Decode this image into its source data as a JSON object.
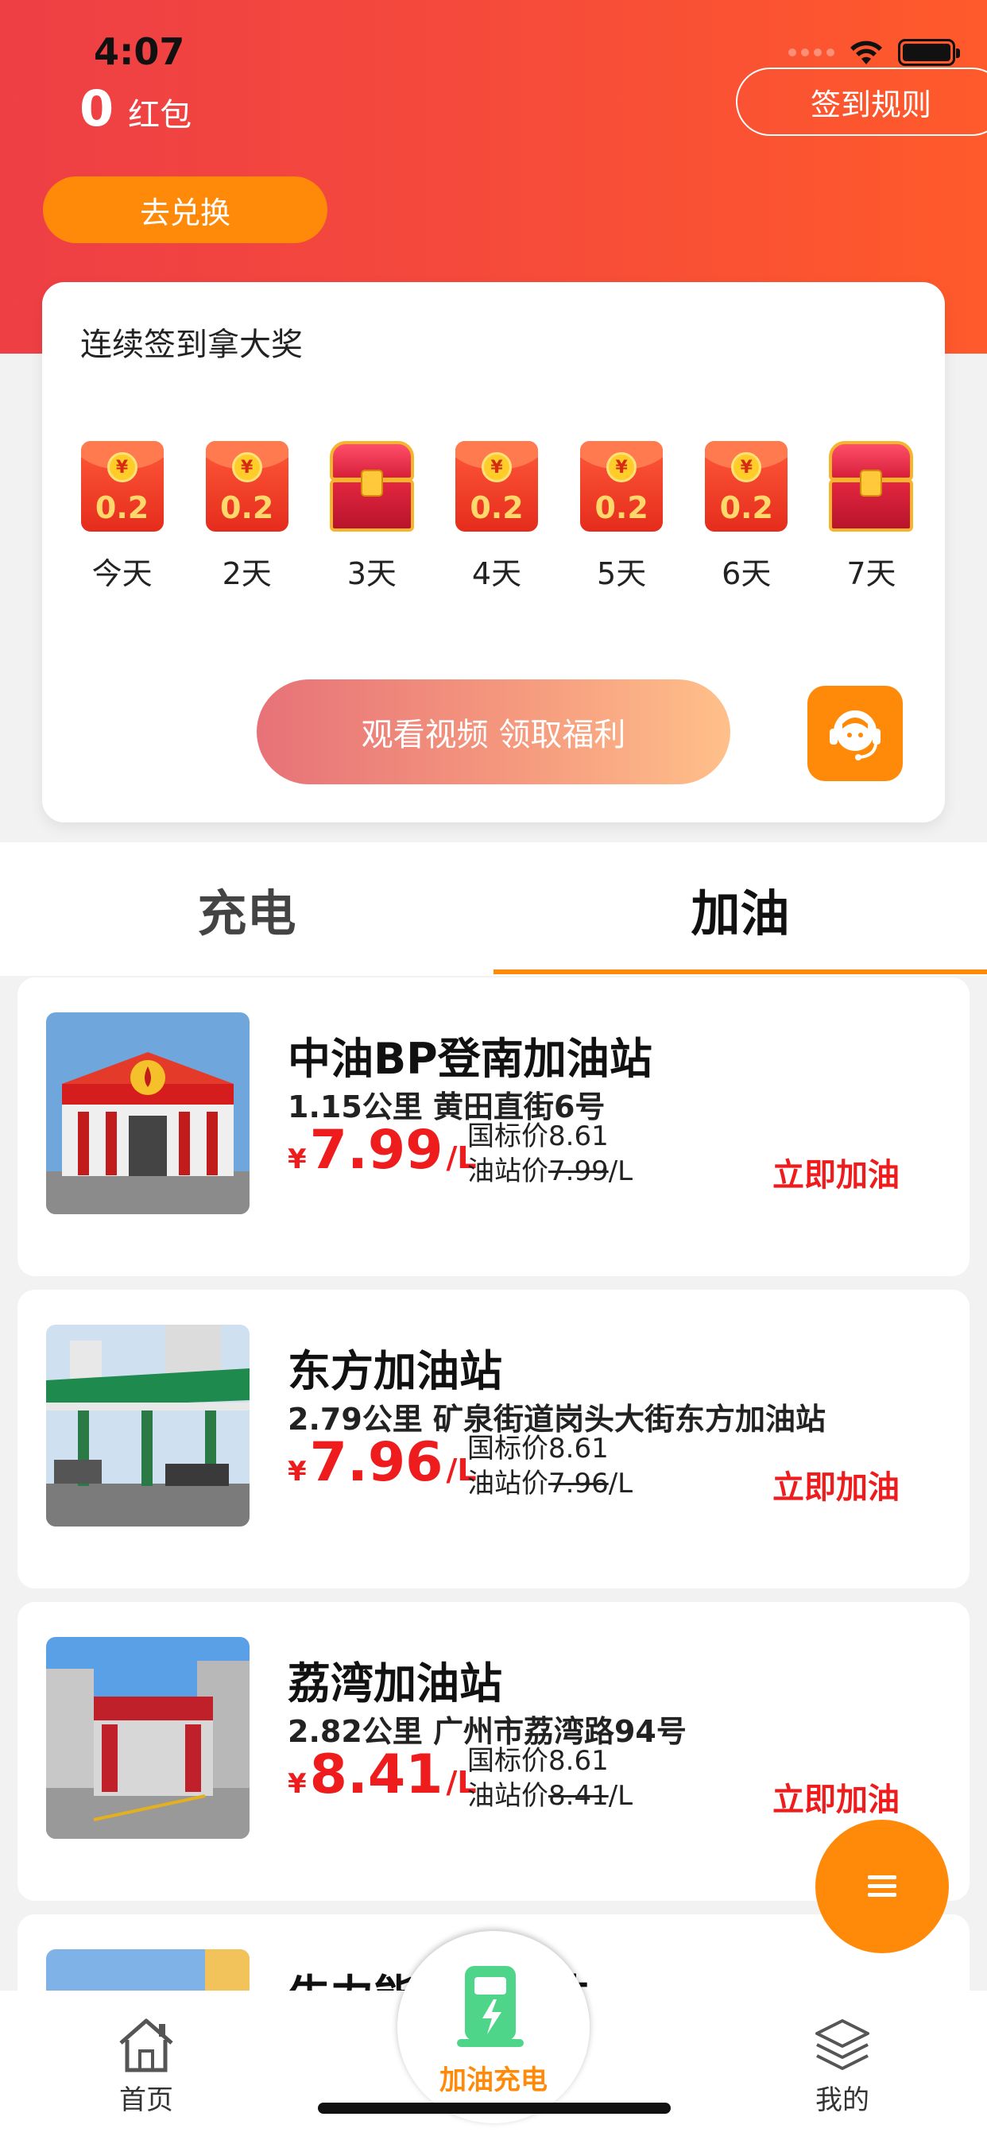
{
  "status_bar": {
    "time": "4:07"
  },
  "header": {
    "points_value": "0",
    "points_label": "红包",
    "rules_button": "签到规则",
    "exchange_button": "去兑换"
  },
  "signin": {
    "title": "连续签到拿大奖",
    "days": [
      {
        "label": "今天",
        "type": "redpack",
        "amount": "0.2"
      },
      {
        "label": "2天",
        "type": "redpack",
        "amount": "0.2"
      },
      {
        "label": "3天",
        "type": "chest",
        "amount": ""
      },
      {
        "label": "4天",
        "type": "redpack",
        "amount": "0.2"
      },
      {
        "label": "5天",
        "type": "redpack",
        "amount": "0.2"
      },
      {
        "label": "6天",
        "type": "redpack",
        "amount": "0.2"
      },
      {
        "label": "7天",
        "type": "chest",
        "amount": ""
      }
    ],
    "coin_symbol": "¥",
    "video_button": "观看视频 领取福利",
    "service_icon": "customer-service-icon"
  },
  "tabs": [
    {
      "label": "充电",
      "active": false
    },
    {
      "label": "加油",
      "active": true
    }
  ],
  "stations": [
    {
      "name": "中油BP登南加油站",
      "distance_address": "1.15公里 黄田直街6号",
      "currency": "¥",
      "price": "7.99",
      "unit": "/L",
      "national_price_label": "国标价8.61",
      "station_price_label": "油站价",
      "station_price": "7.99",
      "station_price_unit": "/L",
      "action": "立即加油"
    },
    {
      "name": "东方加油站",
      "distance_address": "2.79公里 矿泉街道岗头大街东方加油站",
      "currency": "¥",
      "price": "7.96",
      "unit": "/L",
      "national_price_label": "国标价8.61",
      "station_price_label": "油站价",
      "station_price": "7.96",
      "station_price_unit": "/L",
      "action": "立即加油"
    },
    {
      "name": "荔湾加油站",
      "distance_address": "2.82公里 广州市荔湾路94号",
      "currency": "¥",
      "price": "8.41",
      "unit": "/L",
      "national_price_label": "国标价8.61",
      "station_price_label": "油站价",
      "station_price": "8.41",
      "station_price_unit": "/L",
      "action": "立即加油"
    },
    {
      "name": "牛力能源加油站",
      "distance_address": "",
      "currency": "",
      "price": "",
      "unit": "",
      "national_price_label": "",
      "station_price_label": "",
      "station_price": "",
      "station_price_unit": "",
      "action": ""
    }
  ],
  "bottom_nav": {
    "home": "首页",
    "center": "加油充电",
    "mine": "我的"
  },
  "colors": {
    "accent_orange": "#ff8a0a",
    "price_red": "#ee1c1c",
    "header_red": "#ee3f45"
  }
}
